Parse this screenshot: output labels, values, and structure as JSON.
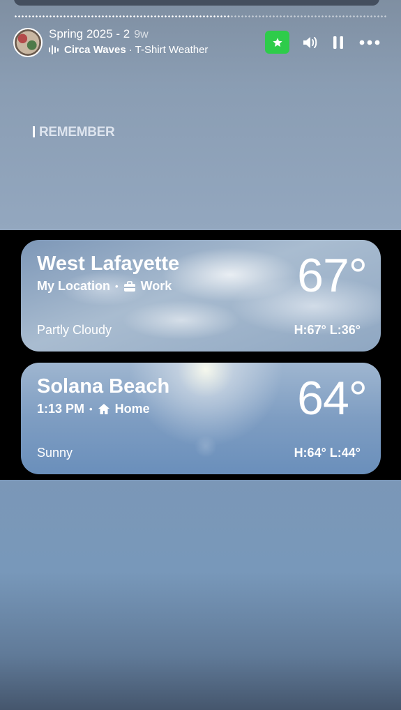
{
  "story": {
    "title": "Spring 2025 - 2",
    "age": "9w",
    "artist": "Circa Waves",
    "separator": "·",
    "song": "T-Shirt Weather",
    "progress": 0.58
  },
  "controls": {
    "favorite_icon": "star-icon",
    "volume_icon": "speaker-icon",
    "pause_icon": "pause-icon",
    "more_icon": "more-icon"
  },
  "caption": {
    "text": "REMEMBER"
  },
  "weather": {
    "cards": [
      {
        "city": "West Lafayette",
        "subtitle_left": "My Location",
        "dot": "•",
        "subtitle_icon": "briefcase-icon",
        "subtitle_right": "Work",
        "temp": "67°",
        "condition": "Partly Cloudy",
        "hl": "H:67°  L:36°"
      },
      {
        "city": "Solana Beach",
        "subtitle_left": "1:13 PM",
        "dot": "•",
        "subtitle_icon": "home-icon",
        "subtitle_right": "Home",
        "temp": "64°",
        "condition": "Sunny",
        "hl": "H:64°  L:44°"
      }
    ]
  },
  "colors": {
    "favorite": "#2ecc4a"
  }
}
